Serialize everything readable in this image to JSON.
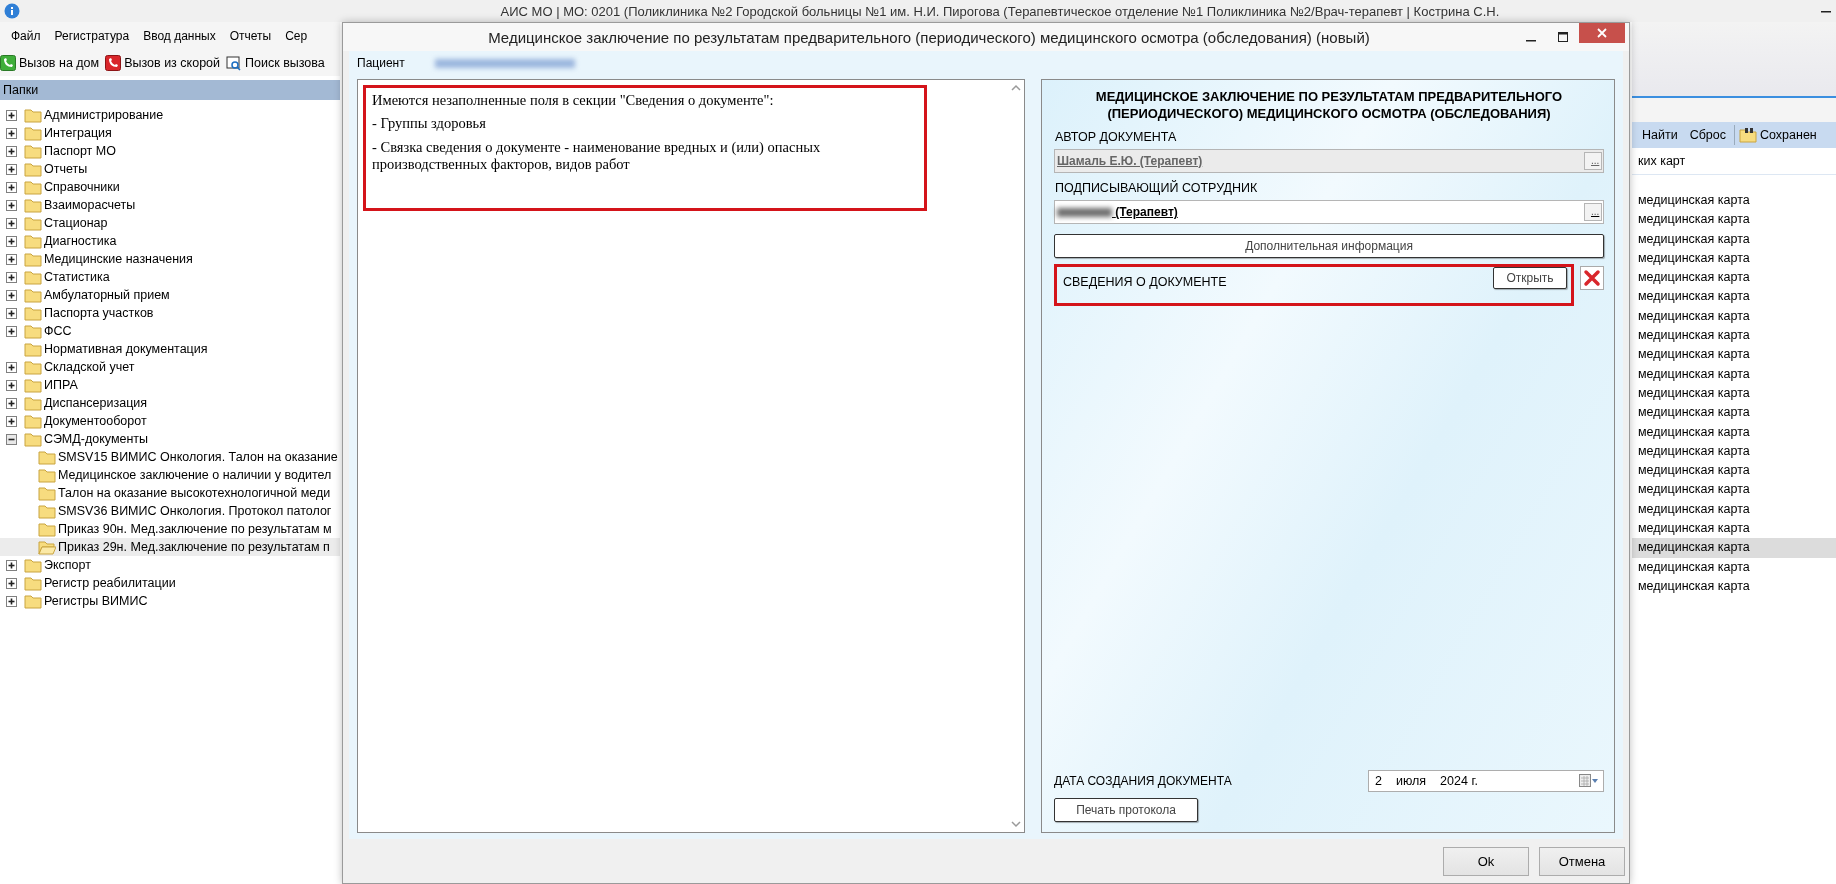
{
  "background_window": {
    "title": "АИС МО | МО: 0201 (Поликлиника №2 Городской больницы №1 им. Н.И. Пирогова (Терапевтическое отделение №1 Поликлиника №2/Врач-терапевт | Кострина С.Н.",
    "menu": [
      "Файл",
      "Регистратура",
      "Ввод данных",
      "Отчеты",
      "Сер"
    ],
    "toolbar": [
      {
        "label": "Вызов на дом",
        "kind": "home-call"
      },
      {
        "label": "Вызов из скорой",
        "kind": "ambulance-call"
      },
      {
        "label": "Поиск вызова",
        "kind": "search"
      }
    ],
    "folders_header": "Папки",
    "tree": [
      {
        "label": "Администрирование",
        "kind": "collapsed",
        "selected": false
      },
      {
        "label": "Интеграция",
        "kind": "collapsed",
        "selected": false
      },
      {
        "label": "Паспорт МО",
        "kind": "collapsed",
        "selected": false
      },
      {
        "label": "Отчеты",
        "kind": "collapsed",
        "selected": false
      },
      {
        "label": "Справочники",
        "kind": "collapsed",
        "selected": false
      },
      {
        "label": "Взаиморасчеты",
        "kind": "collapsed",
        "selected": false
      },
      {
        "label": "Стационар",
        "kind": "collapsed",
        "selected": false
      },
      {
        "label": "Диагностика",
        "kind": "collapsed",
        "selected": false
      },
      {
        "label": "Медицинские назначения",
        "kind": "collapsed",
        "selected": false
      },
      {
        "label": "Статистика",
        "kind": "collapsed",
        "selected": false
      },
      {
        "label": "Амбулаторный прием",
        "kind": "collapsed",
        "selected": false
      },
      {
        "label": "Паспорта участков",
        "kind": "collapsed",
        "selected": false
      },
      {
        "label": "ФСС",
        "kind": "collapsed",
        "selected": false
      },
      {
        "label": "Нормативная документация",
        "kind": "leaf",
        "selected": false
      },
      {
        "label": "Складской учет",
        "kind": "collapsed",
        "selected": false
      },
      {
        "label": "ИПРА",
        "kind": "collapsed",
        "selected": false
      },
      {
        "label": "Диспансеризация",
        "kind": "collapsed",
        "selected": false
      },
      {
        "label": "Документооборот",
        "kind": "collapsed",
        "selected": false
      },
      {
        "label": "СЭМД-документы",
        "kind": "expanded",
        "selected": false,
        "children": [
          {
            "label": "SMSV15 ВИМИС Онкология. Талон на оказание",
            "selected": false
          },
          {
            "label": "Медицинское заключение о наличии у водител",
            "selected": false
          },
          {
            "label": "Талон на оказание высокотехнологичной меди",
            "selected": false
          },
          {
            "label": "SMSV36 ВИМИС Онкология. Протокол патолог",
            "selected": false
          },
          {
            "label": "Приказ 90н. Мед.заключение по результатам м",
            "selected": false
          },
          {
            "label": "Приказ 29н. Мед.заключение по результатам п",
            "selected": true
          }
        ]
      },
      {
        "label": "Экспорт",
        "kind": "collapsed",
        "selected": false
      },
      {
        "label": "Регистр реабилитации",
        "kind": "collapsed",
        "selected": false
      },
      {
        "label": "Регистры ВИМИС",
        "kind": "collapsed",
        "selected": false
      }
    ],
    "list_toolbar": [
      {
        "label": "Найти",
        "kind": "text"
      },
      {
        "label": "Сброс",
        "kind": "text"
      },
      {
        "label": "Сохранен",
        "kind": "saved"
      }
    ],
    "list_header": "ких карт",
    "list_rows": [
      {
        "text": "медицинская карта",
        "selected": false
      },
      {
        "text": "медицинская карта",
        "selected": false
      },
      {
        "text": "медицинская карта",
        "selected": false
      },
      {
        "text": "медицинская карта",
        "selected": false
      },
      {
        "text": "медицинская карта",
        "selected": false
      },
      {
        "text": "медицинская карта",
        "selected": false
      },
      {
        "text": "медицинская карта",
        "selected": false
      },
      {
        "text": "медицинская карта",
        "selected": false
      },
      {
        "text": "медицинская карта",
        "selected": false
      },
      {
        "text": "медицинская карта",
        "selected": false
      },
      {
        "text": "медицинская карта",
        "selected": false
      },
      {
        "text": "медицинская карта",
        "selected": false
      },
      {
        "text": "медицинская карта",
        "selected": false
      },
      {
        "text": "медицинская карта",
        "selected": false
      },
      {
        "text": "медицинская карта",
        "selected": false
      },
      {
        "text": "медицинская карта",
        "selected": false
      },
      {
        "text": "медицинская карта",
        "selected": false
      },
      {
        "text": "медицинская карта",
        "selected": false
      },
      {
        "text": "медицинская карта",
        "selected": true
      },
      {
        "text": "медицинская карта",
        "selected": false
      },
      {
        "text": "медицинская карта",
        "selected": false
      }
    ]
  },
  "dialog": {
    "title": "Медицинское заключение по результатам предварительного (периодического) медицинского осмотра (обследования) (новый)",
    "patient_label": "Пациент",
    "messages": [
      "Имеются незаполненные поля в секции \"Сведения о документе\":",
      "- Группы здоровья",
      "- Связка сведения о документе - наименование вредных и (или) опасных производственных факторов, видов работ"
    ],
    "form": {
      "heading": "МЕДИЦИНСКОЕ ЗАКЛЮЧЕНИЕ ПО РЕЗУЛЬТАТАМ ПРЕДВАРИТЕЛЬНОГО (ПЕРИОДИЧЕСКОГО) МЕДИЦИНСКОГО ОСМОТРА (ОБСЛЕДОВАНИЯ)",
      "fields": [
        {
          "label": "АВТОР ДОКУМЕНТА",
          "value": "Шамаль Е.Ю. (Терапевт)",
          "disabled": true,
          "redacted": false,
          "browse": "..."
        },
        {
          "label": "ПОДПИСЫВАЮЩИЙ СОТРУДНИК",
          "value": "(Терапевт)",
          "disabled": false,
          "redacted": true,
          "browse": "..."
        }
      ],
      "extra_button": "Дополнительная информация",
      "section": {
        "label": "СВЕДЕНИЯ О ДОКУМЕНТЕ",
        "open_button": "Открыть",
        "highlighted": true
      },
      "date": {
        "label": "ДАТА СОЗДАНИЯ ДОКУМЕНТА",
        "day": "2",
        "month": "июля",
        "year": "2024 г."
      },
      "print_button": "Печать протокола"
    },
    "buttons": [
      "Ok",
      "Отмена"
    ]
  }
}
